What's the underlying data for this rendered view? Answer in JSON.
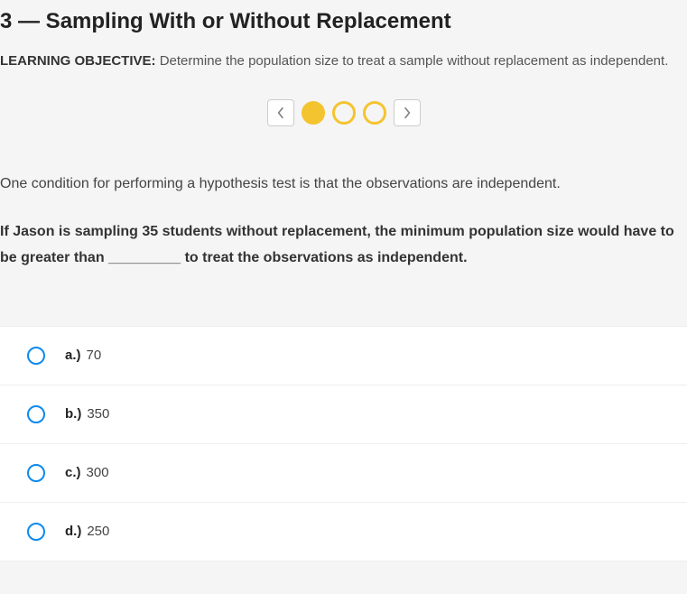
{
  "title": "3 — Sampling With or Without Replacement",
  "learning_objective": {
    "label": "LEARNING OBJECTIVE:",
    "text": "Determine the population size to treat a sample without replacement as independent."
  },
  "pagination": {
    "total": 3,
    "current": 1
  },
  "question": {
    "intro": "One condition for performing a hypothesis test is that the observations are independent.",
    "prompt": "If Jason is sampling 35 students without replacement, the minimum population size would have to be greater than _________ to treat the observations as independent."
  },
  "options": [
    {
      "letter": "a.)",
      "value": "70"
    },
    {
      "letter": "b.)",
      "value": "350"
    },
    {
      "letter": "c.)",
      "value": "300"
    },
    {
      "letter": "d.)",
      "value": "250"
    }
  ]
}
